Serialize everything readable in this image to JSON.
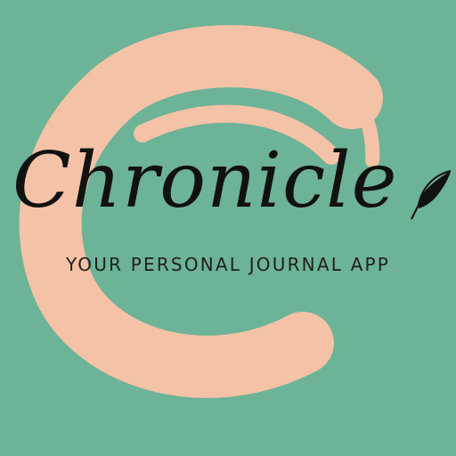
{
  "app": {
    "name": "Chronicle",
    "tagline": "YOUR PERSONAL JOURNAL APP"
  },
  "icons": {
    "brush_stroke": "brush-circle-icon",
    "feather": "feather-quill-icon"
  },
  "colors": {
    "background": "#6db397",
    "brush": "#f4c2a6",
    "text": "#111111"
  }
}
